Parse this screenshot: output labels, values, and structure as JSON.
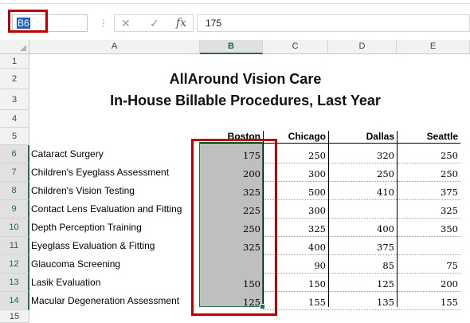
{
  "formula_bar": {
    "name_box": "B6",
    "separator_icon": "⋮",
    "cancel_icon": "✕",
    "enter_icon": "✓",
    "fx_icon": "fx",
    "formula_value": "175"
  },
  "columns": [
    "A",
    "B",
    "C",
    "D",
    "E"
  ],
  "rows": [
    "1",
    "2",
    "3",
    "4",
    "5",
    "6",
    "7",
    "8",
    "9",
    "10",
    "11",
    "12",
    "13",
    "14",
    "15"
  ],
  "titles": {
    "line1": "AllAround Vision Care",
    "line2": "In-House Billable Procedures, Last Year"
  },
  "headers": [
    "Boston",
    "Chicago",
    "Dallas",
    "Seattle"
  ],
  "procedures": [
    "Cataract Surgery",
    "Children's Eyeglass Assessment",
    "Children's Vision Testing",
    "Contact Lens Evaluation and Fitting",
    "Depth Perception Training",
    "Eyeglass Evaluation & Fitting",
    "Glaucoma Screening",
    "Lasik Evaluation",
    "Macular Degeneration Assessment"
  ],
  "values": [
    [
      "175",
      "250",
      "320",
      "250"
    ],
    [
      "200",
      "300",
      "250",
      "250"
    ],
    [
      "325",
      "500",
      "410",
      "375"
    ],
    [
      "225",
      "300",
      "",
      "325"
    ],
    [
      "250",
      "325",
      "400",
      "350"
    ],
    [
      "325",
      "400",
      "375",
      ""
    ],
    [
      "",
      "90",
      "85",
      "75"
    ],
    [
      "150",
      "150",
      "125",
      "200"
    ],
    [
      "125",
      "155",
      "135",
      "155"
    ]
  ]
}
